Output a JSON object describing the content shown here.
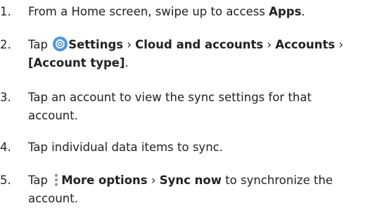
{
  "steps": [
    {
      "number": "1.",
      "before": "From a Home screen, swipe up to access ",
      "apps": "Apps",
      "end": "."
    },
    {
      "number": "2.",
      "tap": "Tap ",
      "settings": "Settings",
      "sep1": " › ",
      "cloud": "Cloud and accounts",
      "sep2": " › ",
      "accounts": "Accounts",
      "sep3": " ›",
      "account_type": "[Account type]",
      "end": "."
    },
    {
      "number": "3.",
      "line1": "Tap an account to view the sync settings for that",
      "line2": "account."
    },
    {
      "number": "4.",
      "text": "Tap individual data items to sync."
    },
    {
      "number": "5.",
      "tap": "Tap ",
      "more_options": "More options",
      "sep": " › ",
      "sync_now": "Sync now",
      "after": " to synchronize the",
      "line2": "account."
    }
  ],
  "icons": {
    "settings": "settings-gear-icon",
    "more_options": "more-options-icon"
  },
  "colors": {
    "text": "#222222",
    "settings_icon": "#4f97d8",
    "more_icon": "#9a9a9a"
  }
}
